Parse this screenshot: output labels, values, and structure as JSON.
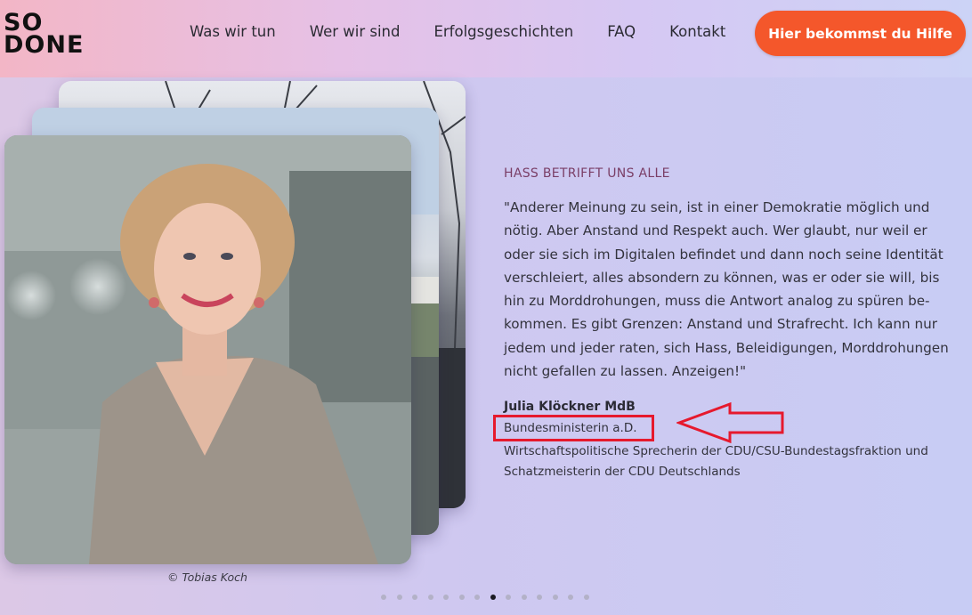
{
  "logo": {
    "line1": "SO",
    "line2": "DONE"
  },
  "nav": {
    "items": [
      {
        "label": "Was wir tun"
      },
      {
        "label": "Wer wir sind"
      },
      {
        "label": "Erfolgsgeschichten"
      },
      {
        "label": "FAQ"
      },
      {
        "label": "Kontakt"
      }
    ],
    "cta_label": "Hier bekommst du Hilfe"
  },
  "slide": {
    "photo_credit": "© Tobias Koch",
    "eyebrow": "HASS BETRIFFT UNS ALLE",
    "quote": "\"Anderer Meinung zu sein, ist in einer Demokratie möglich und nötig. Aber Anstand und Respekt auch. Wer glaubt, nur weil er oder sie sich im Digitalen befindet und dann noch seine Identität verschleiert, alles absondern zu können, was er oder sie will, bis hin zu Morddrohungen, muss die Antwort analog zu spüren be-kommen. Es gibt Grenzen: Anstand und Strafrecht. Ich kann nur jedem und jeder raten, sich Hass, Beleidigungen, Morddrohungen nicht gefallen zu lassen. Anzeigen!\"",
    "author": "Julia Klöckner MdB",
    "role_highlighted": "Bundesministerin a.D.",
    "role_rest": "Wirtschaftspolitische Sprecherin der CDU/CSU-Bundestagsfraktion und Schatzmeisterin der CDU Deutschlands"
  },
  "pager": {
    "total": 14,
    "active_index": 7
  },
  "colors": {
    "cta": "#f4572b",
    "annotation": "#e6192d",
    "eyebrow": "#7a3e66"
  }
}
